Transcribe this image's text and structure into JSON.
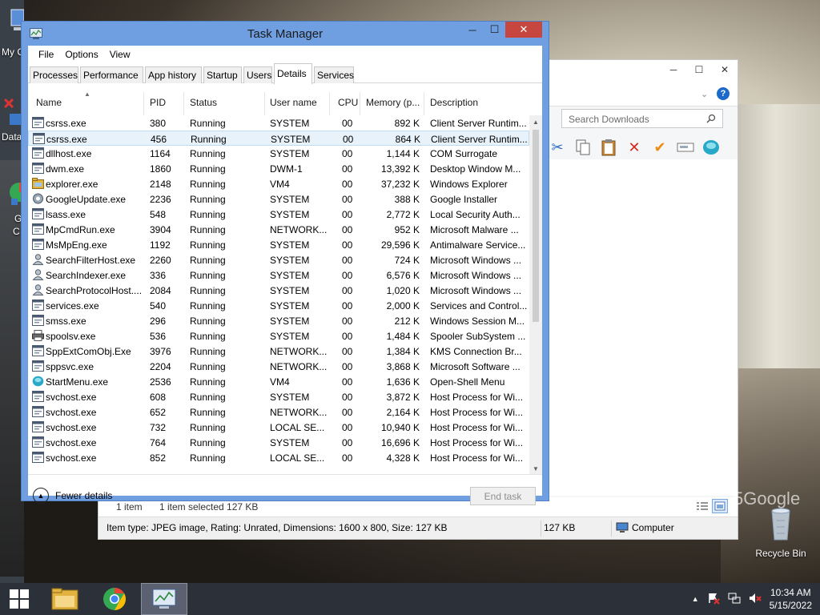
{
  "desktop": {
    "icons": [
      {
        "label": "My C"
      },
      {
        "label": "Data"
      },
      {
        "label": "G"
      },
      {
        "label": "C"
      },
      {
        "label": "Recycle Bin"
      }
    ],
    "watermark": "5Google"
  },
  "explorer": {
    "search_placeholder": "Search Downloads",
    "status": {
      "item_count": "1 item",
      "selected": "1 item selected  127 KB"
    },
    "details_bar": {
      "info": "Item type: JPEG image, Rating: Unrated, Dimensions: 1600 x 800, Size: 127 KB",
      "size": "127 KB",
      "location": "Computer"
    }
  },
  "taskmgr": {
    "title": "Task Manager",
    "menu": [
      "File",
      "Options",
      "View"
    ],
    "tabs": [
      "Processes",
      "Performance",
      "App history",
      "Startup",
      "Users",
      "Details",
      "Services"
    ],
    "active_tab": "Details",
    "columns": [
      "Name",
      "PID",
      "Status",
      "User name",
      "CPU",
      "Memory (p...",
      "Description"
    ],
    "rows": [
      {
        "name": "csrss.exe",
        "pid": "380",
        "status": "Running",
        "user": "SYSTEM",
        "cpu": "00",
        "mem": "892 K",
        "desc": "Client Server Runtim...",
        "icon": "window-icon"
      },
      {
        "name": "csrss.exe",
        "pid": "456",
        "status": "Running",
        "user": "SYSTEM",
        "cpu": "00",
        "mem": "864 K",
        "desc": "Client Server Runtim...",
        "icon": "window-icon"
      },
      {
        "name": "dllhost.exe",
        "pid": "1164",
        "status": "Running",
        "user": "SYSTEM",
        "cpu": "00",
        "mem": "1,144 K",
        "desc": "COM Surrogate",
        "icon": "window-icon"
      },
      {
        "name": "dwm.exe",
        "pid": "1860",
        "status": "Running",
        "user": "DWM-1",
        "cpu": "00",
        "mem": "13,392 K",
        "desc": "Desktop Window M...",
        "icon": "window-icon"
      },
      {
        "name": "explorer.exe",
        "pid": "2148",
        "status": "Running",
        "user": "VM4",
        "cpu": "00",
        "mem": "37,232 K",
        "desc": "Windows Explorer",
        "icon": "folder-icon"
      },
      {
        "name": "GoogleUpdate.exe",
        "pid": "2236",
        "status": "Running",
        "user": "SYSTEM",
        "cpu": "00",
        "mem": "388 K",
        "desc": "Google Installer",
        "icon": "gear-icon"
      },
      {
        "name": "lsass.exe",
        "pid": "548",
        "status": "Running",
        "user": "SYSTEM",
        "cpu": "00",
        "mem": "2,772 K",
        "desc": "Local Security Auth...",
        "icon": "window-icon"
      },
      {
        "name": "MpCmdRun.exe",
        "pid": "3904",
        "status": "Running",
        "user": "NETWORK...",
        "cpu": "00",
        "mem": "952 K",
        "desc": "Microsoft Malware ...",
        "icon": "window-icon"
      },
      {
        "name": "MsMpEng.exe",
        "pid": "1192",
        "status": "Running",
        "user": "SYSTEM",
        "cpu": "00",
        "mem": "29,596 K",
        "desc": "Antimalware Service...",
        "icon": "window-icon"
      },
      {
        "name": "SearchFilterHost.exe",
        "pid": "2260",
        "status": "Running",
        "user": "SYSTEM",
        "cpu": "00",
        "mem": "724 K",
        "desc": "Microsoft Windows ...",
        "icon": "person-icon"
      },
      {
        "name": "SearchIndexer.exe",
        "pid": "336",
        "status": "Running",
        "user": "SYSTEM",
        "cpu": "00",
        "mem": "6,576 K",
        "desc": "Microsoft Windows ...",
        "icon": "person-icon"
      },
      {
        "name": "SearchProtocolHost....",
        "pid": "2084",
        "status": "Running",
        "user": "SYSTEM",
        "cpu": "00",
        "mem": "1,020 K",
        "desc": "Microsoft Windows ...",
        "icon": "person-icon"
      },
      {
        "name": "services.exe",
        "pid": "540",
        "status": "Running",
        "user": "SYSTEM",
        "cpu": "00",
        "mem": "2,000 K",
        "desc": "Services and Control...",
        "icon": "window-icon"
      },
      {
        "name": "smss.exe",
        "pid": "296",
        "status": "Running",
        "user": "SYSTEM",
        "cpu": "00",
        "mem": "212 K",
        "desc": "Windows Session M...",
        "icon": "window-icon"
      },
      {
        "name": "spoolsv.exe",
        "pid": "536",
        "status": "Running",
        "user": "SYSTEM",
        "cpu": "00",
        "mem": "1,484 K",
        "desc": "Spooler SubSystem ...",
        "icon": "printer-icon"
      },
      {
        "name": "SppExtComObj.Exe",
        "pid": "3976",
        "status": "Running",
        "user": "NETWORK...",
        "cpu": "00",
        "mem": "1,384 K",
        "desc": "KMS Connection Br...",
        "icon": "window-icon"
      },
      {
        "name": "sppsvc.exe",
        "pid": "2204",
        "status": "Running",
        "user": "NETWORK...",
        "cpu": "00",
        "mem": "3,868 K",
        "desc": "Microsoft Software ...",
        "icon": "window-icon"
      },
      {
        "name": "StartMenu.exe",
        "pid": "2536",
        "status": "Running",
        "user": "VM4",
        "cpu": "00",
        "mem": "1,636 K",
        "desc": "Open-Shell Menu",
        "icon": "shell-icon"
      },
      {
        "name": "svchost.exe",
        "pid": "608",
        "status": "Running",
        "user": "SYSTEM",
        "cpu": "00",
        "mem": "3,872 K",
        "desc": "Host Process for Wi...",
        "icon": "window-icon"
      },
      {
        "name": "svchost.exe",
        "pid": "652",
        "status": "Running",
        "user": "NETWORK...",
        "cpu": "00",
        "mem": "2,164 K",
        "desc": "Host Process for Wi...",
        "icon": "window-icon"
      },
      {
        "name": "svchost.exe",
        "pid": "732",
        "status": "Running",
        "user": "LOCAL SE...",
        "cpu": "00",
        "mem": "10,940 K",
        "desc": "Host Process for Wi...",
        "icon": "window-icon"
      },
      {
        "name": "svchost.exe",
        "pid": "764",
        "status": "Running",
        "user": "SYSTEM",
        "cpu": "00",
        "mem": "16,696 K",
        "desc": "Host Process for Wi...",
        "icon": "window-icon"
      },
      {
        "name": "svchost.exe",
        "pid": "852",
        "status": "Running",
        "user": "LOCAL SE...",
        "cpu": "00",
        "mem": "4,328 K",
        "desc": "Host Process for Wi...",
        "icon": "window-icon"
      }
    ],
    "selected_row": 1,
    "fewer_details": "Fewer details",
    "end_task": "End task"
  },
  "taskbar": {
    "clock_time": "10:34 AM",
    "clock_date": "5/15/2022"
  },
  "colors": {
    "taskmgr_frame": "#6f9fe0",
    "close_button": "#c7463f",
    "selection": "#e8f2fb",
    "taskbar": "#2c3038"
  }
}
